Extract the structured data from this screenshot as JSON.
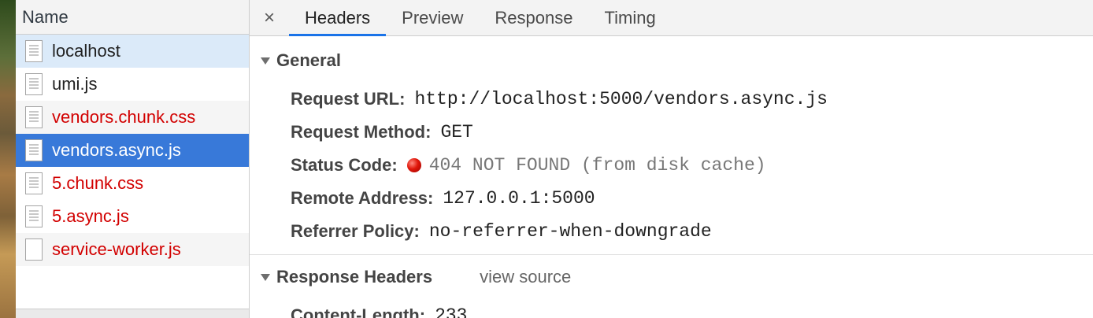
{
  "name_panel": {
    "header": "Name",
    "rows": [
      {
        "label": "localhost",
        "state": "hover",
        "status": "normal",
        "icon": "document-icon"
      },
      {
        "label": "umi.js",
        "state": "normal",
        "status": "normal",
        "icon": "document-icon"
      },
      {
        "label": "vendors.chunk.css",
        "state": "alt",
        "status": "error",
        "icon": "document-icon"
      },
      {
        "label": "vendors.async.js",
        "state": "selected",
        "status": "error",
        "icon": "document-icon"
      },
      {
        "label": "5.chunk.css",
        "state": "normal",
        "status": "error",
        "icon": "document-icon"
      },
      {
        "label": "5.async.js",
        "state": "normal",
        "status": "error",
        "icon": "document-icon"
      },
      {
        "label": "service-worker.js",
        "state": "alt",
        "status": "error",
        "icon": "blank-document-icon"
      }
    ]
  },
  "tabs": {
    "close": "×",
    "items": [
      {
        "label": "Headers",
        "active": true
      },
      {
        "label": "Preview",
        "active": false
      },
      {
        "label": "Response",
        "active": false
      },
      {
        "label": "Timing",
        "active": false
      }
    ]
  },
  "general": {
    "title": "General",
    "request_url_key": "Request URL:",
    "request_url_val": "http://localhost:5000/vendors.async.js",
    "request_method_key": "Request Method:",
    "request_method_val": "GET",
    "status_code_key": "Status Code:",
    "status_code_val": "404 NOT FOUND (from disk cache)",
    "status_color": "#e0170a",
    "remote_address_key": "Remote Address:",
    "remote_address_val": "127.0.0.1:5000",
    "referrer_policy_key": "Referrer Policy:",
    "referrer_policy_val": "no-referrer-when-downgrade"
  },
  "response_headers": {
    "title": "Response Headers",
    "view_source": "view source",
    "content_length_key": "Content-Length:",
    "content_length_val": "233"
  },
  "colors": {
    "selected": "#3879d9",
    "hover": "#dbeaf9",
    "error_text": "#d20000",
    "tab_underline": "#1a73e8"
  }
}
